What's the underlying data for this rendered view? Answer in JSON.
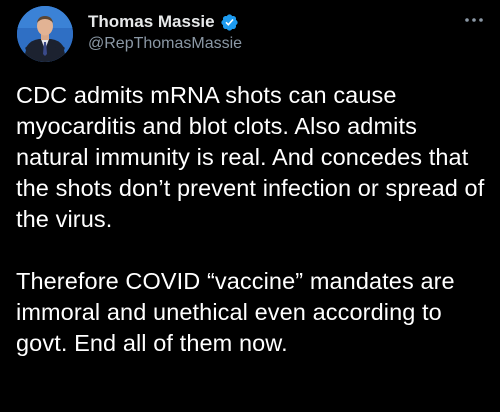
{
  "tweet": {
    "author": {
      "display_name": "Thomas Massie",
      "handle": "@RepThomasMassie",
      "verified": true
    },
    "more_icon": "more-horizontal-icon",
    "paragraphs": [
      "CDC admits mRNA shots can cause myocarditis and blot clots. Also admits natural immunity is real. And concedes that the shots don’t prevent infection or spread of the virus.",
      "Therefore COVID “vaccine” mandates are immoral and unethical even according to govt. End all of them now."
    ]
  },
  "colors": {
    "background": "#000000",
    "text": "#ffffff",
    "secondary_text": "#8b98a5",
    "verified_badge": "#1d9bf0"
  }
}
